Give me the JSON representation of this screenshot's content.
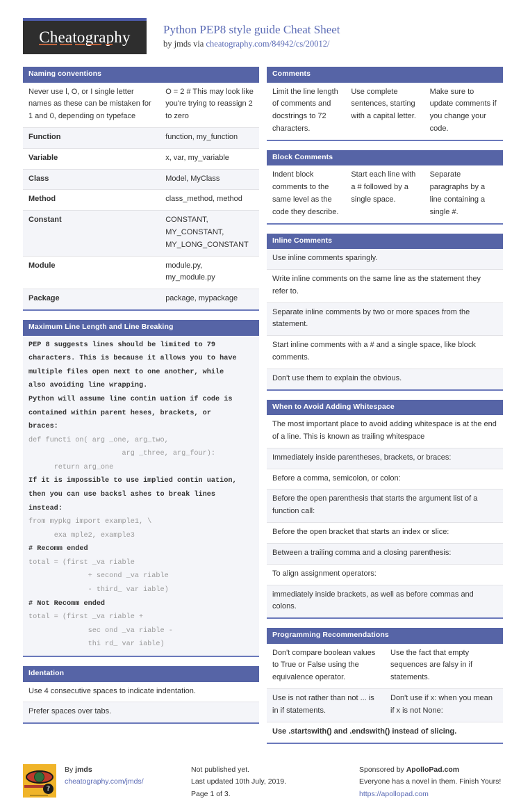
{
  "header": {
    "logo_text": "Cheatography",
    "title": "Python PEP8 style guide Cheat Sheet",
    "by_prefix": "by ",
    "author": "jmds",
    "via": " via ",
    "source_url": "cheatography.com/84942/cs/20012/"
  },
  "colors": {
    "section_header_bg": "#5664a6",
    "section_border": "#6b79bb",
    "accent_link": "#5b6bb5",
    "logo_bg": "#2e2e2e",
    "logo_underline": "#c1643c",
    "row_alt_bg": "#f4f5f9",
    "avatar_bg": "#f0b429"
  },
  "left_column": {
    "naming_conventions": {
      "title": "Naming conventions",
      "rows": [
        {
          "left": "Never use l, O, or I single letter names as these can be mistaken for 1 and 0, depending on typeface",
          "right": "O = 2 # This may look like you're trying to reassign 2 to zero"
        },
        {
          "left": "Function",
          "right": "function, my_function"
        },
        {
          "left": "Variable",
          "right": "x, var, my_variable"
        },
        {
          "left": "Class",
          "right": "Model, MyClass"
        },
        {
          "left": "Method",
          "right": "class_method, method"
        },
        {
          "left": "Constant",
          "right": "CONSTANT, MY_CONSTANT, MY_LONG_CONSTANT"
        },
        {
          "left": "Module",
          "right": "module.py, my_module.py"
        },
        {
          "left": "Package",
          "right": "package, mypackage"
        }
      ]
    },
    "max_line_length": {
      "title": "Maximum Line Length and Line Breaking",
      "lines": [
        {
          "kind": "text",
          "text": "PEP 8 suggests lines should be limited to 79"
        },
        {
          "kind": "text",
          "text": "characters. This is because it allows you to have"
        },
        {
          "kind": "text",
          "text": "multiple files open next to one another, while"
        },
        {
          "kind": "text",
          "text": "also avoiding line wrapping."
        },
        {
          "kind": "text",
          "text": "Python will assume line contin uation if code is"
        },
        {
          "kind": "text",
          "text": "contained within parent heses, brackets, or"
        },
        {
          "kind": "text",
          "text": "braces:"
        },
        {
          "kind": "code",
          "text": "def functi on( arg _one, arg_two,"
        },
        {
          "kind": "code",
          "text": "                      arg _three, arg_four):"
        },
        {
          "kind": "code",
          "text": "      return arg_one"
        },
        {
          "kind": "text",
          "text": "If it is impossible to use implied contin uation,"
        },
        {
          "kind": "text",
          "text": "then you can use backsl ashes to break lines"
        },
        {
          "kind": "text",
          "text": "instead:"
        },
        {
          "kind": "code",
          "text": "from mypkg import example1, \\"
        },
        {
          "kind": "code",
          "text": "      exa mple2, example3"
        },
        {
          "kind": "text",
          "text": "# Recomm ended"
        },
        {
          "kind": "code",
          "text": "total = (first _va riable"
        },
        {
          "kind": "code",
          "text": "              + second _va riable"
        },
        {
          "kind": "code",
          "text": "              - third_ var iable)"
        },
        {
          "kind": "text",
          "text": "# Not Recomm ended"
        },
        {
          "kind": "code",
          "text": "total = (first _va riable +"
        },
        {
          "kind": "code",
          "text": "              sec ond _va riable -"
        },
        {
          "kind": "code",
          "text": "              thi rd_ var iable)"
        }
      ]
    },
    "identation": {
      "title": "Identation",
      "rows": [
        "Use 4 consecutive spaces to indicate indentation.",
        "Prefer spaces over tabs."
      ]
    }
  },
  "right_column": {
    "comments": {
      "title": "Comments",
      "row": [
        "Limit the line length of comments and docstrings to 72 characters.",
        "Use complete sentences, starting with a capital letter.",
        "Make sure to update comments if you change your code."
      ]
    },
    "block_comments": {
      "title": "Block Comments",
      "row": [
        "Indent block comments to the same level as the code they describe.",
        "Start each line with a # followed by a single space.",
        "Separate paragraphs by a line containing a single #."
      ]
    },
    "inline_comments": {
      "title": "Inline Comments",
      "rows": [
        "Use inline comments sparingly.",
        "Write inline comments on the same line as the statement they refer to.",
        "Separate inline comments by two or more spaces from the statement.",
        "Start inline comments with a # and a single space, like block comments.",
        "Don't use them to explain the obvious."
      ]
    },
    "avoid_whitespace": {
      "title": "When to Avoid Adding Whitespace",
      "rows": [
        "The most important place to avoid adding whitespace is at the end of a line. This is known as trailing whitespace",
        "Immediately inside parentheses, brackets, or braces:",
        "Before a comma, semicolon, or colon:",
        "Before the open parenthesis that starts the argument list of a function call:",
        "Before the open bracket that starts an index or slice:",
        "Between a trailing comma and a closing parenthesis:",
        "To align assignment operators:",
        "immediately inside brackets, as well as before commas and colons."
      ]
    },
    "programming_recommendations": {
      "title": "Programming Recommendations",
      "rows": [
        {
          "left": "Don't compare boolean values to True or False using the equivalence operator.",
          "right": "Use the fact that empty sequences are falsy in if statements."
        },
        {
          "left": "Use is not rather than not ... is in if statements.",
          "right": "Don't use if x: when you mean if x is not None:"
        }
      ],
      "full_row": "Use .startswith() and .endswith() instead of slicing."
    }
  },
  "footer": {
    "author_block": {
      "by_label": "By ",
      "author": "jmds",
      "profile_url": "cheatography.com/jmds/",
      "avatar_question_mark": "?"
    },
    "publish_block": {
      "line1": "Not published yet.",
      "line2": "Last updated 10th July, 2019.",
      "line3": "Page 1 of 3."
    },
    "sponsor_block": {
      "prefix": "Sponsored by ",
      "name": "ApolloPad.com",
      "tagline": "Everyone has a novel in them. Finish Yours!",
      "url": "https://apollopad.com"
    }
  }
}
